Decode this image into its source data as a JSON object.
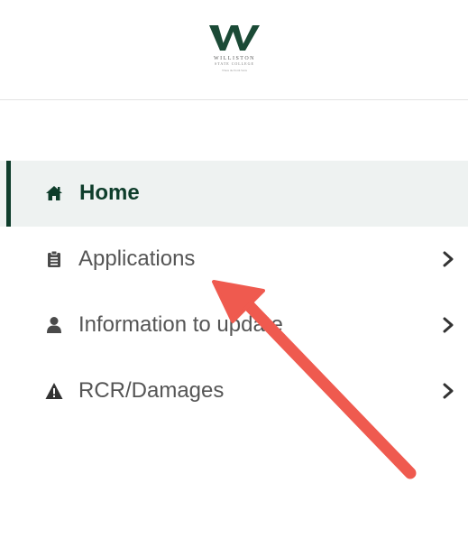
{
  "header": {
    "logo": {
      "icon": "williston-w-logo",
      "line1": "WILLISTON",
      "line2": "STATE COLLEGE",
      "line3": "Where the North Starts"
    }
  },
  "nav": {
    "items": [
      {
        "label": "Home",
        "icon": "home-icon",
        "active": true,
        "has_chevron": false
      },
      {
        "label": "Applications",
        "icon": "clipboard-icon",
        "active": false,
        "has_chevron": true
      },
      {
        "label": "Information to update",
        "icon": "user-icon",
        "active": false,
        "has_chevron": true
      },
      {
        "label": "RCR/Damages",
        "icon": "warning-icon",
        "active": false,
        "has_chevron": true
      }
    ]
  },
  "annotation": {
    "icon": "red-arrow-annotation",
    "target": "Applications"
  },
  "colors": {
    "brand_green": "#0e3d2b",
    "active_bg": "#eef2f1",
    "text": "#555555",
    "arrow": "#ef5a4f"
  }
}
